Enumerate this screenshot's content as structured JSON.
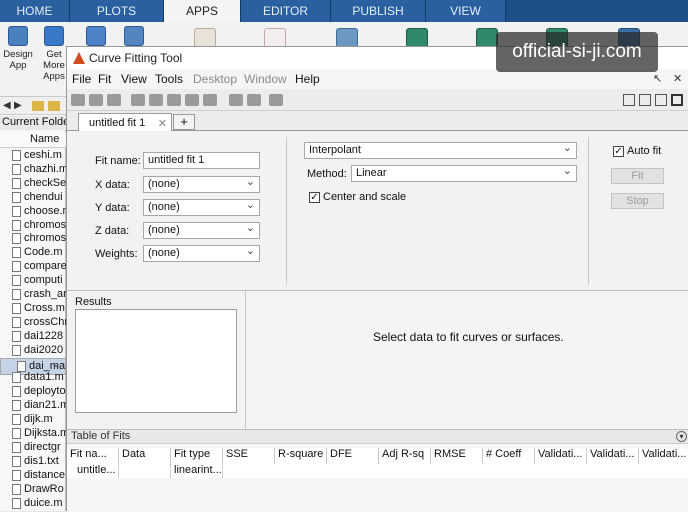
{
  "ribbon": {
    "tabs": [
      "HOME",
      "PLOTS",
      "APPS",
      "EDITOR",
      "PUBLISH",
      "VIEW"
    ],
    "active_tab": "APPS",
    "buttons": [
      {
        "label": "Design App"
      },
      {
        "label": "Get More Apps"
      },
      {
        "label": ""
      }
    ]
  },
  "watermark": "official-si-ji.com",
  "left_panel": {
    "title": "Current Folder",
    "column": "Name",
    "files": [
      "ceshi.m",
      "chazhi.m",
      "checkSe",
      "chendui",
      "choose.m",
      "chromos",
      "chromos",
      "Code.m",
      "compare",
      "computi",
      "crash_ar",
      "Cross.m",
      "crossChr",
      "dai1228",
      "dai2020",
      "dai_math",
      "data1.m",
      "deployto",
      "dian21.m",
      "dijk.m",
      "Dijksta.m",
      "directgr",
      "dis1.txt",
      "distance",
      "DrawRo",
      "duice.m"
    ],
    "selected_index": 15
  },
  "cft": {
    "title": "Curve Fitting Tool",
    "menus": [
      {
        "label": "File",
        "enabled": true
      },
      {
        "label": "Fit",
        "enabled": true
      },
      {
        "label": "View",
        "enabled": true
      },
      {
        "label": "Tools",
        "enabled": true
      },
      {
        "label": "Desktop",
        "enabled": false
      },
      {
        "label": "Window",
        "enabled": false
      },
      {
        "label": "Help",
        "enabled": true
      }
    ],
    "tab_label": "untitled fit 1",
    "tab_add": "+",
    "fit_name_label": "Fit name:",
    "fit_name_value": "untitled fit 1",
    "x_label": "X data:",
    "x_value": "(none)",
    "y_label": "Y data:",
    "y_value": "(none)",
    "z_label": "Z data:",
    "z_value": "(none)",
    "weights_label": "Weights:",
    "weights_value": "(none)",
    "fit_type": "Interpolant",
    "method_label": "Method:",
    "method_value": "Linear",
    "center_scale_label": "Center and scale",
    "center_scale_checked": true,
    "auto_fit_label": "Auto fit",
    "auto_fit_checked": true,
    "fit_button": "Fit",
    "stop_button": "Stop",
    "results_title": "Results",
    "plot_message": "Select data to fit curves or surfaces.",
    "table_title": "Table of Fits",
    "table_columns": [
      "Fit na...",
      "Data",
      "Fit type",
      "SSE",
      "R-square",
      "DFE",
      "Adj R-sq",
      "RMSE",
      "# Coeff",
      "Validati...",
      "Validati...",
      "Validati..."
    ],
    "table_rows": [
      [
        "untitle...",
        "",
        "linearint...",
        "",
        "",
        "",
        "",
        "",
        "",
        "",
        "",
        ""
      ]
    ]
  }
}
